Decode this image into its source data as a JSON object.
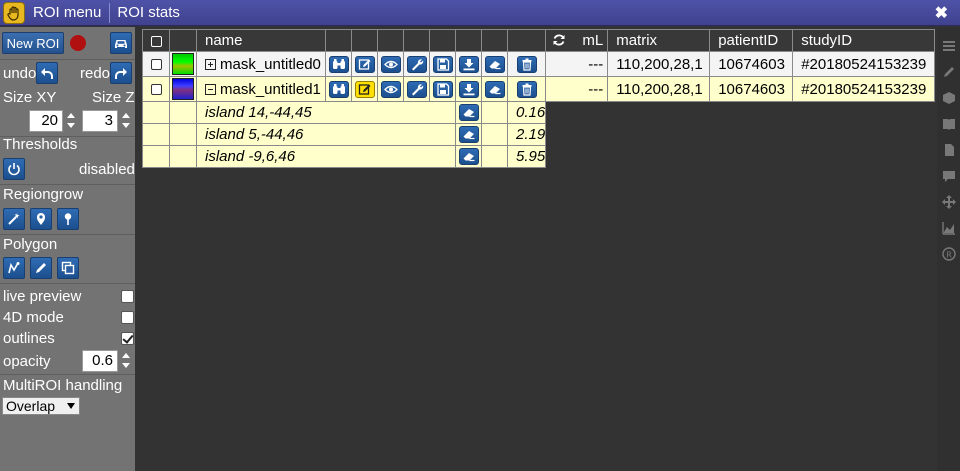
{
  "titlebar": {
    "title1": "ROI menu",
    "title2": "ROI stats",
    "close": "✖"
  },
  "sidebar": {
    "new_roi_label": "New ROI",
    "undo_label": "undo",
    "redo_label": "redo",
    "size_xy_label": "Size XY",
    "size_z_label": "Size Z",
    "size_xy_value": "20",
    "size_z_value": "3",
    "thresholds_label": "Thresholds",
    "thresholds_status": "disabled",
    "regiongrow_label": "Regiongrow",
    "polygon_label": "Polygon",
    "live_preview_label": "live preview",
    "live_preview_checked": false,
    "mode4d_label": "4D mode",
    "mode4d_checked": false,
    "outlines_label": "outlines",
    "outlines_checked": true,
    "opacity_label": "opacity",
    "opacity_value": "0.6",
    "multiroi_label": "MultiROI handling",
    "multiroi_selected": "Overlap"
  },
  "table": {
    "headers": {
      "name": "name",
      "ml": "mL",
      "matrix": "matrix",
      "patientID": "patientID",
      "studyID": "studyID"
    },
    "rows": [
      {
        "name": "mask_untitled0",
        "ml": "---",
        "matrix": "110,200,28,1",
        "patientID": "10674603",
        "studyID": "#20180524153239",
        "expanded": false,
        "color": "#00ff00"
      },
      {
        "name": "mask_untitled1",
        "ml": "---",
        "matrix": "110,200,28,1",
        "patientID": "10674603",
        "studyID": "#20180524153239",
        "expanded": true,
        "color": "#2020ff"
      }
    ],
    "islands": [
      {
        "name": "island 14,-44,45",
        "ml": "0.16"
      },
      {
        "name": "island 5,-44,46",
        "ml": "2.19"
      },
      {
        "name": "island -9,6,46",
        "ml": "5.95"
      }
    ]
  },
  "colors": {
    "titlebar": "#4447a0",
    "sidebar": "#737373",
    "background": "#333333",
    "header": "#383838",
    "row_selected": "#ffffcc",
    "button_blue": "#2a5fa3",
    "record": "#b01010"
  }
}
